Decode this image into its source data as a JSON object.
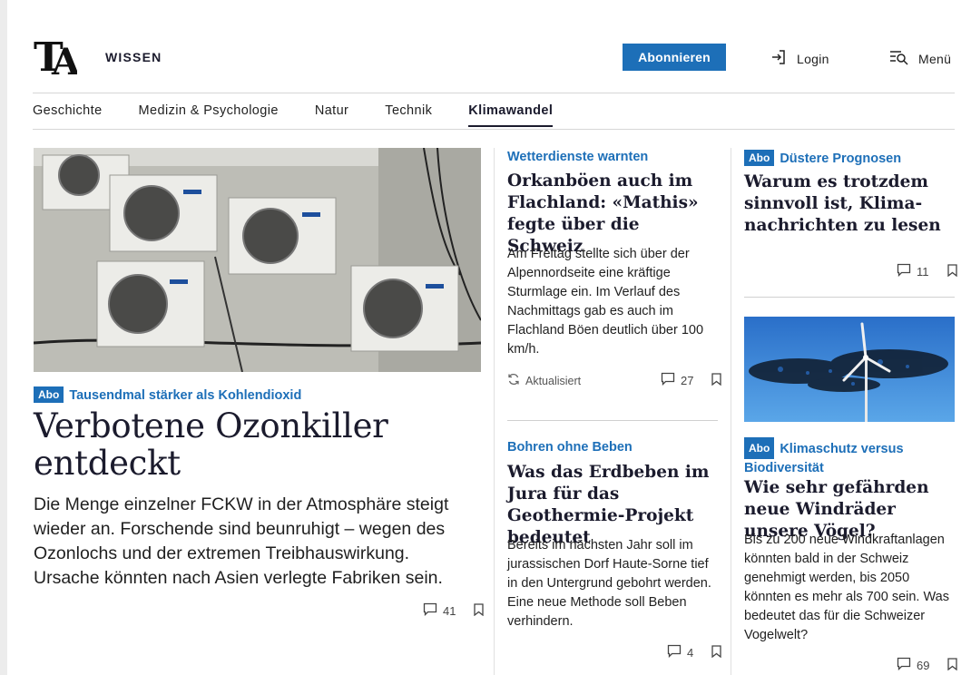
{
  "header": {
    "section": "WISSEN",
    "subscribe_label": "Abonnieren",
    "login_label": "Login",
    "menu_label": "Menü",
    "brand_color": "#1d6fb8"
  },
  "nav": {
    "items": [
      "Geschichte",
      "Medizin & Psychologie",
      "Natur",
      "Technik",
      "Klimawandel"
    ],
    "active": "Klimawandel"
  },
  "main_article": {
    "badge": "Abo",
    "kicker": "Tausendmal stärker als Kohlendioxid",
    "headline": "Verbotene Ozonkiller entdeckt",
    "lead": "Die Menge einzelner FCKW in der Atmosphäre steigt wieder an. Forschende sind beunruhigt – wegen des Ozonlochs und der extremen Treibhauswirkung. Ursache könnten nach Asien verlegte Fabriken sein.",
    "comments": "41"
  },
  "middle": [
    {
      "kicker": "Wetterdienste warnten",
      "headline": "Orkanböen auch im Flachland: «Mathis» fegte über die Schweiz",
      "lead": "Am Freitag stellte sich über der Alpennordseite eine kräftige Sturmlage ein. Im Verlauf des Nachmittags gab es auch im Flachland Böen deutlich über 100 km/h.",
      "status": "Aktualisiert",
      "comments": "27"
    },
    {
      "kicker": "Bohren ohne Beben",
      "headline": "Was das Erdbeben im Jura für das Geothermie-Projekt bedeutet",
      "lead": "Bereits im nächsten Jahr soll im jurassischen Dorf Haute-Sorne tief in den Untergrund gebohrt werden. Eine neue Methode soll Beben verhindern.",
      "comments": "4"
    }
  ],
  "right": [
    {
      "badge": "Abo",
      "kicker": "Düstere Prognosen",
      "headline": "Warum es trotzdem sinnvoll ist, Klima­nachrichten zu lesen",
      "comments": "11"
    },
    {
      "badge": "Abo",
      "kicker": "Klimaschutz versus Biodiversität",
      "headline": "Wie sehr gefährden neue Windräder unsere Vögel?",
      "lead": "Bis zu 200 neue Windkraftanlagen könnten bald in der Schweiz genehmigt werden, bis 2050 könnten es mehr als 700 sein. Was bedeutet das für die Schweizer Vogelwelt?",
      "comments": "69"
    }
  ]
}
